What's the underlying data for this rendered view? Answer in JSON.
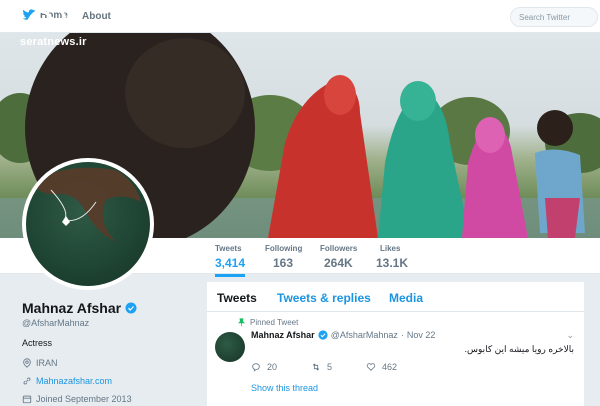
{
  "nav": {
    "home_label": "Home",
    "about_label": "About",
    "search_placeholder": "Search Twitter"
  },
  "watermark": {
    "site": "seratnews.ir"
  },
  "stats": [
    {
      "label": "Tweets",
      "value": "3,414",
      "active": true
    },
    {
      "label": "Following",
      "value": "163"
    },
    {
      "label": "Followers",
      "value": "264K"
    },
    {
      "label": "Likes",
      "value": "13.1K"
    }
  ],
  "profile": {
    "name": "Mahnaz Afshar",
    "handle": "@AfsharMahnaz",
    "bio": "Actress",
    "location": "IRAN",
    "website": "Mahnazafshar.com",
    "joined": "Joined September 2013"
  },
  "tabs": [
    "Tweets",
    "Tweets & replies",
    "Media"
  ],
  "tweet": {
    "pinned_label": "Pinned Tweet",
    "author": "Mahnaz Afshar",
    "handle": "@AfsharMahnaz",
    "separator": "·",
    "date": "Nov 22",
    "text": "بالاخره رویا میشه این کابوس.",
    "replies": "20",
    "retweets": "5",
    "likes": "462",
    "show_thread": "Show this thread"
  },
  "colors": {
    "accent": "#1da1f2",
    "link": "#1b95e0",
    "pin": "#17bf63"
  }
}
